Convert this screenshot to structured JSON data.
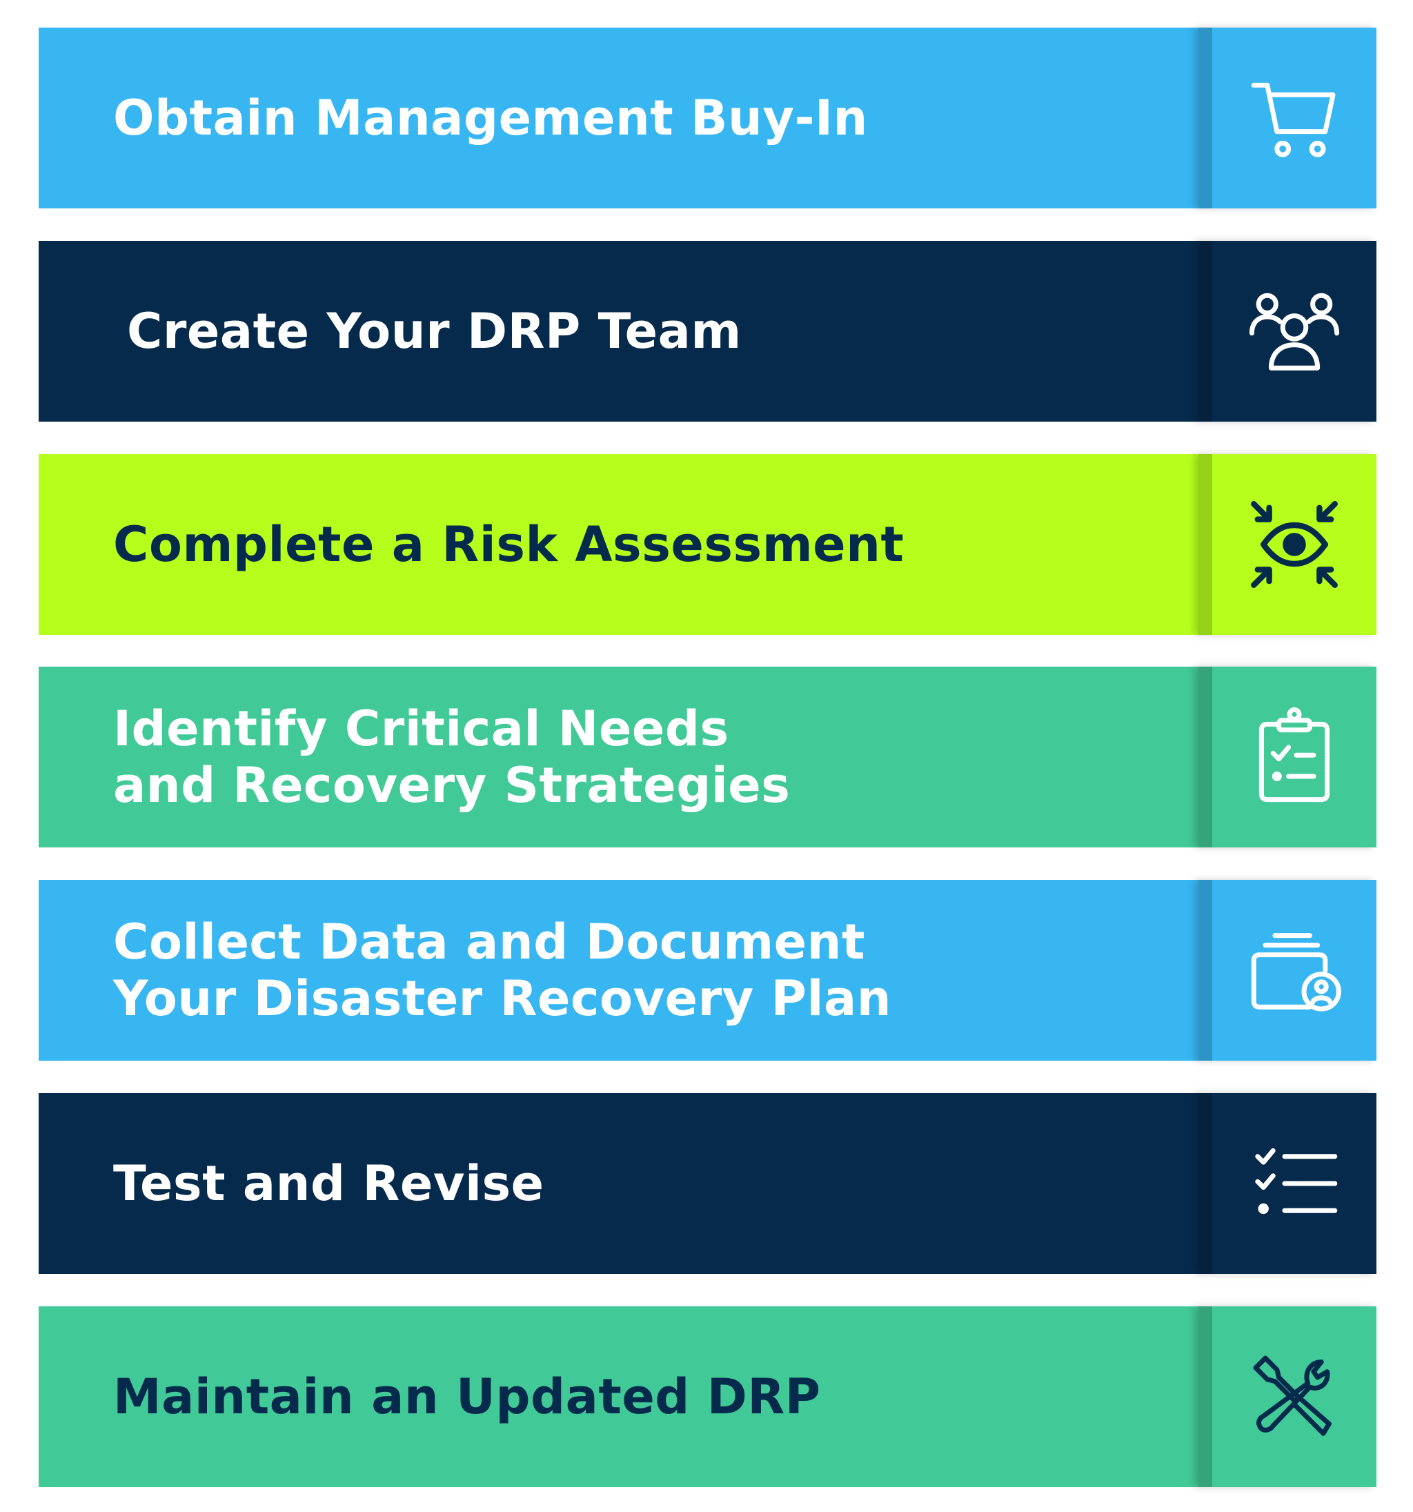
{
  "colors": {
    "sky_blue": "#38b6f2",
    "navy": "#062a4c",
    "lime": "#b6ff1c",
    "teal": "#41c997",
    "white": "#ffffff"
  },
  "steps": [
    {
      "lines": [
        "Obtain Management Buy-In"
      ],
      "icon": "shopping-cart-icon"
    },
    {
      "lines": [
        "Create Your DRP Team"
      ],
      "icon": "team-people-icon"
    },
    {
      "lines": [
        "Complete a Risk Assessment"
      ],
      "icon": "eye-focus-icon"
    },
    {
      "lines": [
        "Identify Critical Needs",
        "and Recovery Strategies"
      ],
      "icon": "clipboard-checklist-icon"
    },
    {
      "lines": [
        "Collect Data and Document",
        "Your Disaster Recovery Plan"
      ],
      "icon": "wallet-user-icon"
    },
    {
      "lines": [
        "Test and Revise"
      ],
      "icon": "checklist-icon"
    },
    {
      "lines": [
        "Maintain an Updated DRP"
      ],
      "icon": "tools-icon"
    }
  ]
}
